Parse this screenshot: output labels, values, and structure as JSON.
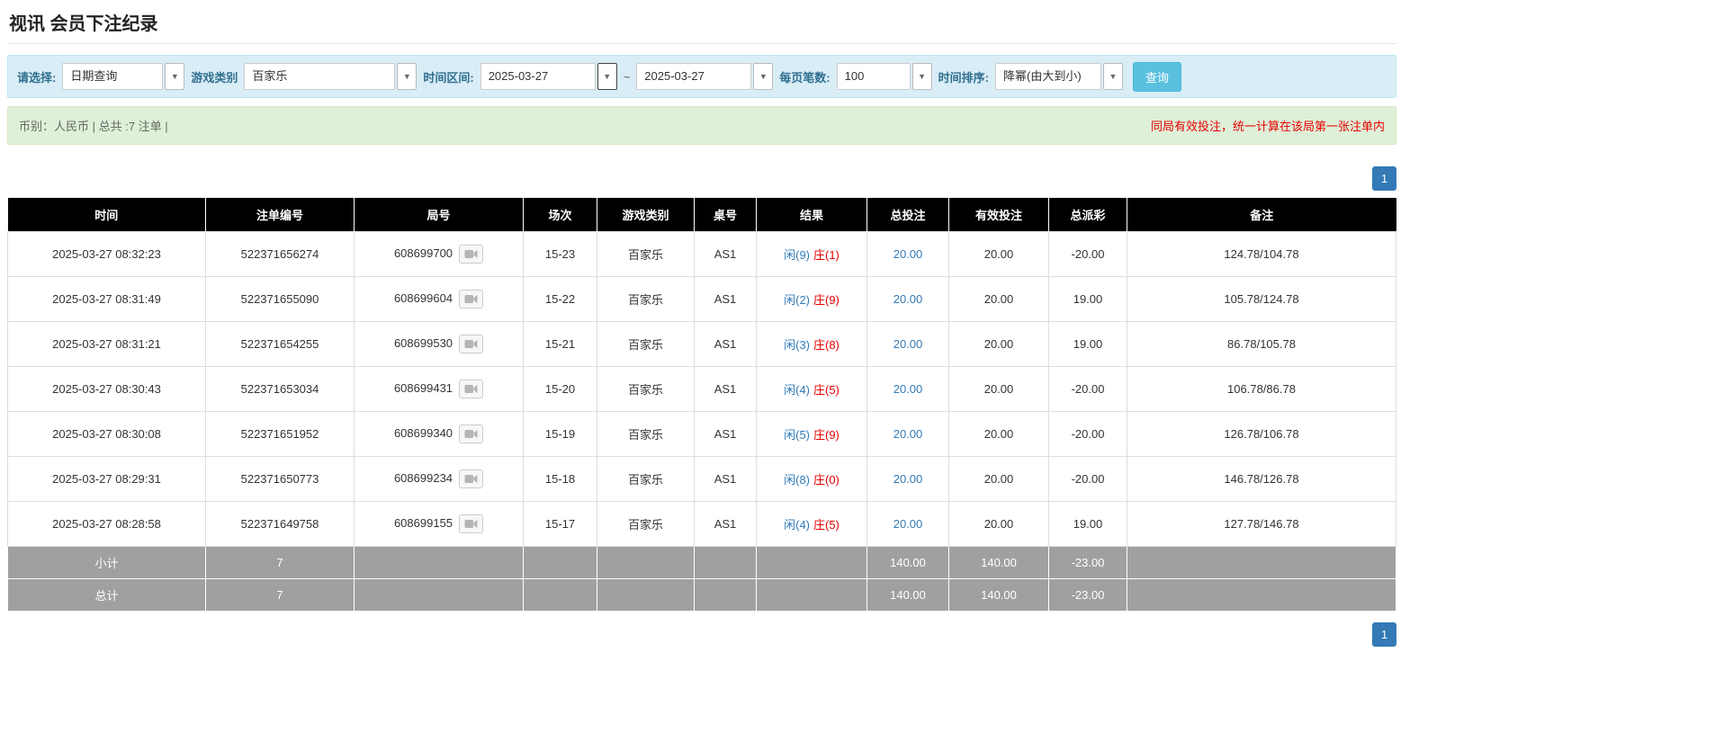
{
  "page": {
    "title": "视讯 会员下注纪录"
  },
  "icons": {
    "caret": "▼",
    "replay_icon": "video-replay"
  },
  "colors": {
    "filter_bar_bg": "#d9edf7",
    "info_bar_bg": "#dff0d8",
    "table_header_bg": "#000000",
    "footer_row_bg": "#a0a0a0",
    "link_blue": "#337ab7",
    "negative_red": "#e60000",
    "query_button_bg": "#5bc0de",
    "pager_blue": "#337ab7"
  },
  "filters": {
    "select_label": "请选择:",
    "select_value": "日期查询",
    "game_type_label": "游戏类别",
    "game_type_value": "百家乐",
    "time_range_label": "时间区间:",
    "date_from": "2025-03-27",
    "range_separator": "~",
    "date_to": "2025-03-27",
    "page_size_label": "每页笔数:",
    "page_size_value": "100",
    "sort_label": "时间排序:",
    "sort_value": "降幂(由大到小)",
    "query_button": "查询"
  },
  "info_bar": {
    "summary": "币别：人民币 | 总共 :7 注单 |",
    "notice": "同局有效投注，统一计算在该局第一张注单内"
  },
  "pagination": {
    "current_page": "1"
  },
  "table": {
    "headers": [
      "时间",
      "注单编号",
      "局号",
      "场次",
      "游戏类别",
      "桌号",
      "结果",
      "总投注",
      "有效投注",
      "总派彩",
      "备注"
    ],
    "rows": [
      {
        "time": "2025-03-27 08:32:23",
        "bet_id": "522371656274",
        "round": "608699700",
        "session": "15-23",
        "game": "百家乐",
        "table_no": "AS1",
        "result_player": "闲(9)",
        "result_banker": "庄(1)",
        "total_bet": "20.00",
        "valid_bet": "20.00",
        "payout": "-20.00",
        "remark": "124.78/104.78"
      },
      {
        "time": "2025-03-27 08:31:49",
        "bet_id": "522371655090",
        "round": "608699604",
        "session": "15-22",
        "game": "百家乐",
        "table_no": "AS1",
        "result_player": "闲(2)",
        "result_banker": "庄(9)",
        "total_bet": "20.00",
        "valid_bet": "20.00",
        "payout": "19.00",
        "remark": "105.78/124.78"
      },
      {
        "time": "2025-03-27 08:31:21",
        "bet_id": "522371654255",
        "round": "608699530",
        "session": "15-21",
        "game": "百家乐",
        "table_no": "AS1",
        "result_player": "闲(3)",
        "result_banker": "庄(8)",
        "total_bet": "20.00",
        "valid_bet": "20.00",
        "payout": "19.00",
        "remark": "86.78/105.78"
      },
      {
        "time": "2025-03-27 08:30:43",
        "bet_id": "522371653034",
        "round": "608699431",
        "session": "15-20",
        "game": "百家乐",
        "table_no": "AS1",
        "result_player": "闲(4)",
        "result_banker": "庄(5)",
        "total_bet": "20.00",
        "valid_bet": "20.00",
        "payout": "-20.00",
        "remark": "106.78/86.78"
      },
      {
        "time": "2025-03-27 08:30:08",
        "bet_id": "522371651952",
        "round": "608699340",
        "session": "15-19",
        "game": "百家乐",
        "table_no": "AS1",
        "result_player": "闲(5)",
        "result_banker": "庄(9)",
        "total_bet": "20.00",
        "valid_bet": "20.00",
        "payout": "-20.00",
        "remark": "126.78/106.78"
      },
      {
        "time": "2025-03-27 08:29:31",
        "bet_id": "522371650773",
        "round": "608699234",
        "session": "15-18",
        "game": "百家乐",
        "table_no": "AS1",
        "result_player": "闲(8)",
        "result_banker": "庄(0)",
        "total_bet": "20.00",
        "valid_bet": "20.00",
        "payout": "-20.00",
        "remark": "146.78/126.78"
      },
      {
        "time": "2025-03-27 08:28:58",
        "bet_id": "522371649758",
        "round": "608699155",
        "session": "15-17",
        "game": "百家乐",
        "table_no": "AS1",
        "result_player": "闲(4)",
        "result_banker": "庄(5)",
        "total_bet": "20.00",
        "valid_bet": "20.00",
        "payout": "19.00",
        "remark": "127.78/146.78"
      }
    ],
    "subtotal": {
      "label": "小计",
      "count": "7",
      "total_bet": "140.00",
      "valid_bet": "140.00",
      "payout": "-23.00"
    },
    "total": {
      "label": "总计",
      "count": "7",
      "total_bet": "140.00",
      "valid_bet": "140.00",
      "payout": "-23.00"
    }
  }
}
